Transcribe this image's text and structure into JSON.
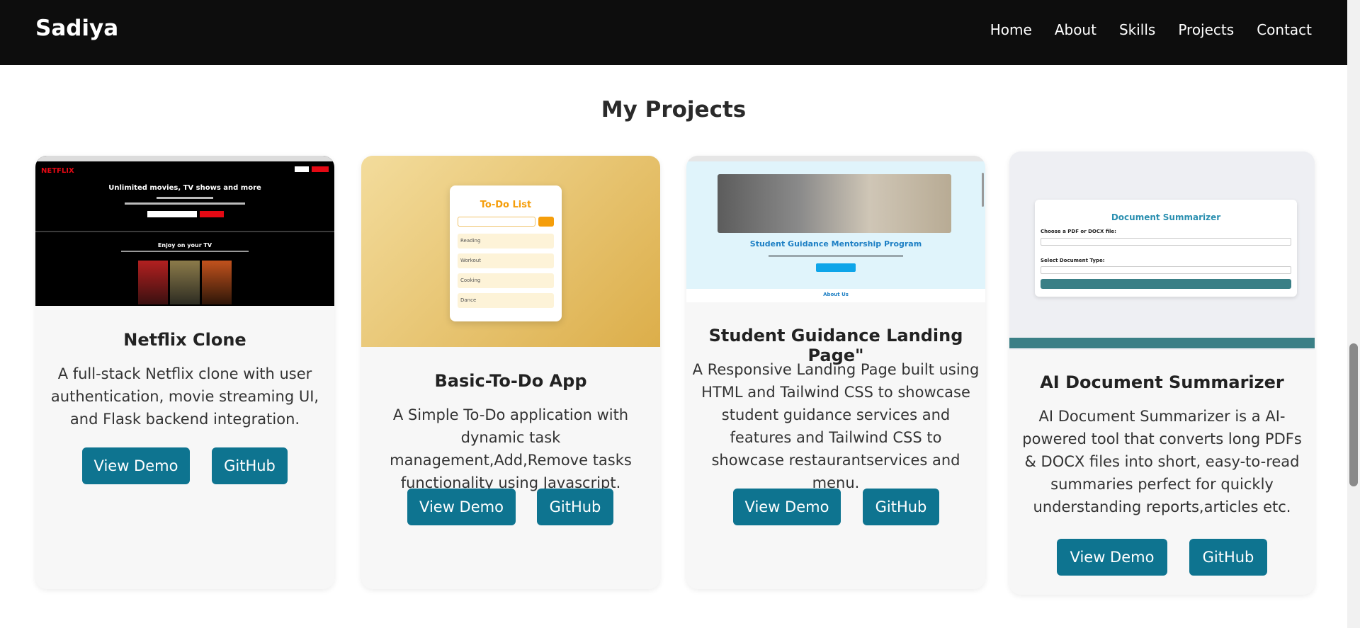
{
  "nav": {
    "brand": "Sadiya",
    "links": [
      "Home",
      "About",
      "Skills",
      "Projects",
      "Contact"
    ]
  },
  "section": {
    "title": "My Projects"
  },
  "projects": [
    {
      "title": "Netflix Clone",
      "description": "A full-stack Netflix clone with user authentication, movie streaming UI, and Flask backend integration.",
      "demo_label": "View Demo",
      "github_label": "GitHub",
      "preview": {
        "logo": "NETFLIX",
        "headline": "Unlimited movies, TV shows and more",
        "enjoy": "Enjoy on your TV"
      }
    },
    {
      "title": "Basic-To-Do App",
      "description": "A Simple To-Do application with dynamic task management,Add,Remove tasks functionality using Javascript.",
      "demo_label": "View Demo",
      "github_label": "GitHub",
      "preview": {
        "heading": "To-Do List",
        "items": [
          "Reading",
          "Workout",
          "Cooking",
          "Dance"
        ]
      }
    },
    {
      "title": "Student Guidance Landing Page\"",
      "description": "A Responsive Landing Page built using HTML and Tailwind CSS to showcase student guidance services and features and Tailwind CSS to showcase restaurantservices and menu.",
      "demo_label": "View Demo",
      "github_label": "GitHub",
      "preview": {
        "heading": "Student Guidance Mentorship Program",
        "about": "About Us"
      }
    },
    {
      "title": "AI Document Summarizer",
      "description": "AI Document Summarizer is a AI-powered tool that converts long PDFs & DOCX files into short, easy-to-read summaries perfect for quickly understanding reports,articles etc.",
      "demo_label": "View Demo",
      "github_label": "GitHub",
      "preview": {
        "heading": "Document Summarizer",
        "label_file": "Choose a PDF or DOCX file:",
        "label_type": "Select Document Type:"
      }
    }
  ],
  "colors": {
    "accent": "#0e7490",
    "navbar": "#0d0d0d",
    "card_bg": "#f7f7f7"
  }
}
